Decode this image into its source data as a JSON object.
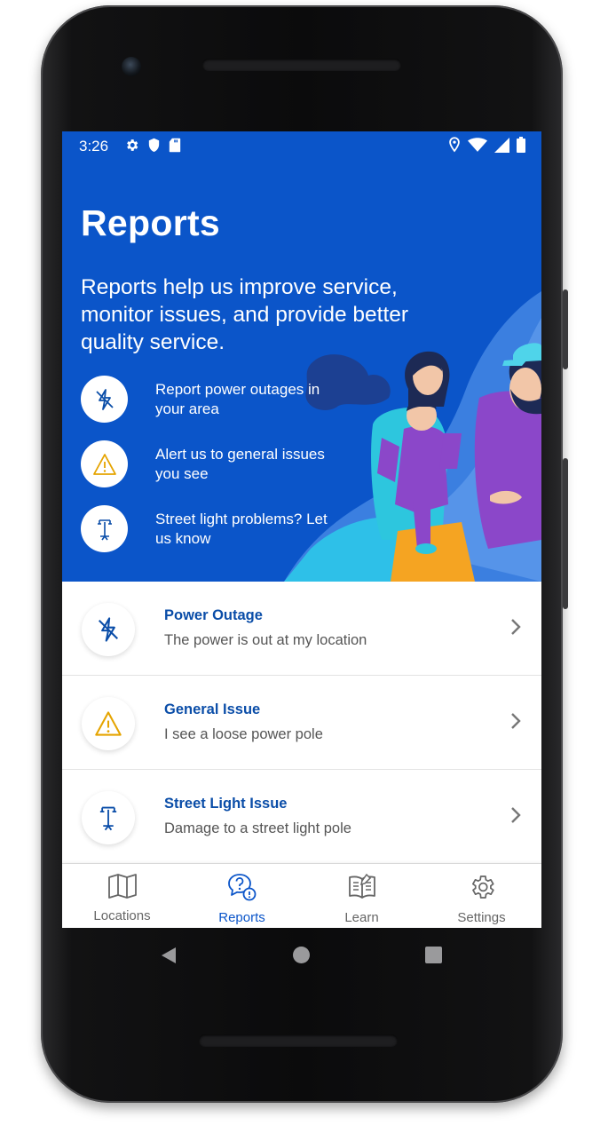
{
  "status_bar": {
    "time": "3:26",
    "left_icons": [
      "gear-icon",
      "shield-icon",
      "sd-card-icon"
    ],
    "right_icons": [
      "location-icon",
      "wifi-icon",
      "signal-icon",
      "battery-icon"
    ]
  },
  "hero": {
    "title": "Reports",
    "description": "Reports help us improve service, monitor issues, and provide better quality service.",
    "features": [
      {
        "icon": "power-outage-icon",
        "text": "Report power outages in your area"
      },
      {
        "icon": "warning-icon",
        "text": "Alert us to general issues you see"
      },
      {
        "icon": "street-light-icon",
        "text": "Street light problems? Let us know"
      }
    ]
  },
  "reports": [
    {
      "icon": "power-outage-icon",
      "title": "Power Outage",
      "subtitle": "The power is out at my location"
    },
    {
      "icon": "warning-icon",
      "title": "General Issue",
      "subtitle": "I see a loose power pole"
    },
    {
      "icon": "street-light-icon",
      "title": "Street Light Issue",
      "subtitle": "Damage to a street light pole"
    }
  ],
  "bottom_nav": {
    "active": "Reports",
    "items": [
      {
        "icon": "map-icon",
        "label": "Locations"
      },
      {
        "icon": "reports-icon",
        "label": "Reports"
      },
      {
        "icon": "book-icon",
        "label": "Learn"
      },
      {
        "icon": "gear-icon",
        "label": "Settings"
      }
    ]
  },
  "colors": {
    "brand_blue": "#0b55c9",
    "title_blue": "#0a4da8",
    "warning_yellow": "#e5a400"
  }
}
